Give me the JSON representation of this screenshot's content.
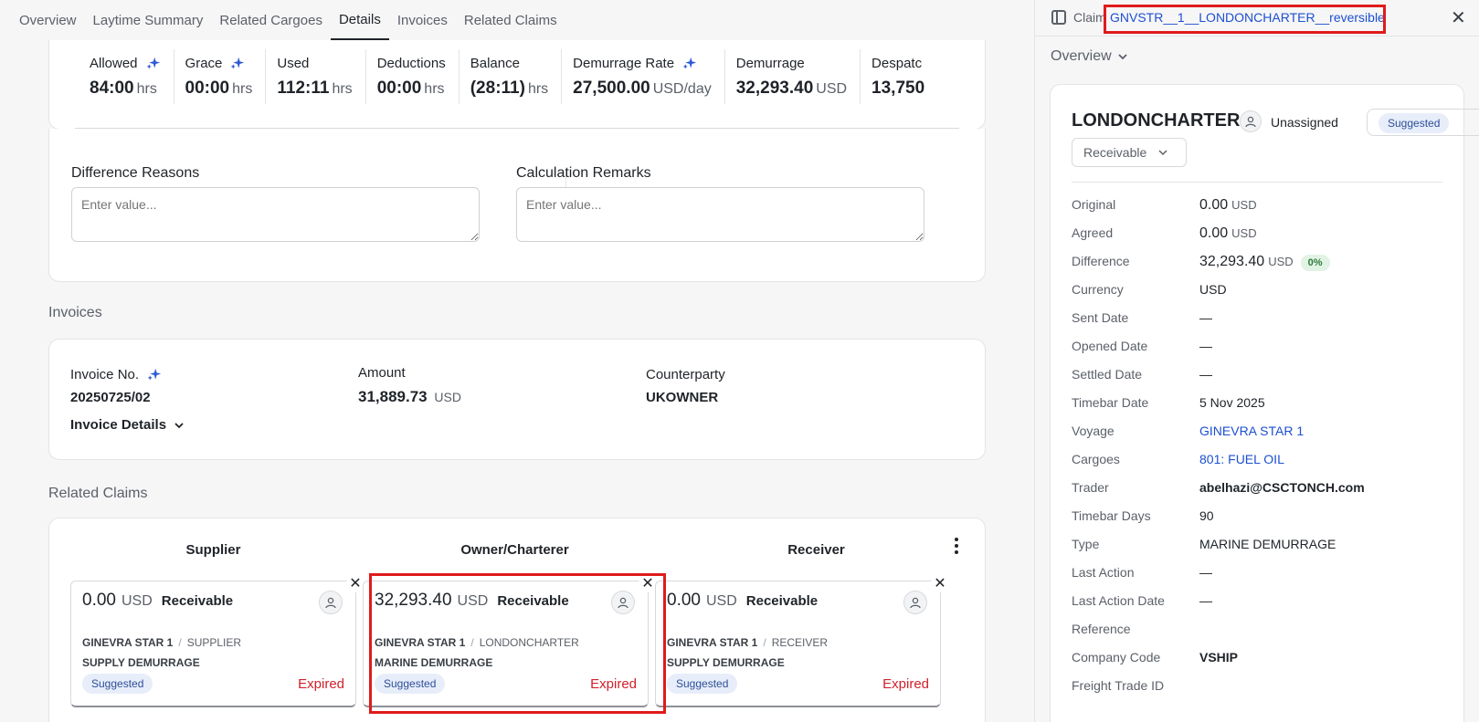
{
  "tabs": [
    "Overview",
    "Laytime Summary",
    "Related Cargoes",
    "Details",
    "Invoices",
    "Related Claims"
  ],
  "stats": [
    {
      "label": "Allowed",
      "value": "84:00",
      "unit": "hrs",
      "sparkle": true
    },
    {
      "label": "Grace",
      "value": "00:00",
      "unit": "hrs",
      "sparkle": true
    },
    {
      "label": "Used",
      "value": "112:11",
      "unit": "hrs",
      "sparkle": false
    },
    {
      "label": "Deductions",
      "value": "00:00",
      "unit": "hrs",
      "sparkle": false
    },
    {
      "label": "Balance",
      "value": "(28:11)",
      "unit": "hrs",
      "sparkle": false
    },
    {
      "label": "Demurrage Rate",
      "value": "27,500.00",
      "unit": "USD/day",
      "sparkle": true
    },
    {
      "label": "Demurrage",
      "value": "32,293.40",
      "unit": "USD",
      "sparkle": false
    },
    {
      "label": "Despatc",
      "value": "13,750",
      "unit": "",
      "sparkle": false
    }
  ],
  "remarks": {
    "difference_label": "Difference Reasons",
    "difference_placeholder": "Enter value...",
    "calculation_label": "Calculation Remarks",
    "calculation_placeholder": "Enter value..."
  },
  "invoices": {
    "section_title": "Invoices",
    "no_label": "Invoice No.",
    "no_value": "20250725/02",
    "amount_label": "Amount",
    "amount_value": "31,889.73",
    "amount_unit": "USD",
    "counterparty_label": "Counterparty",
    "counterparty_value": "UKOWNER",
    "details_label": "Invoice Details"
  },
  "related_claims": {
    "section_title": "Related Claims",
    "columns": [
      "Supplier",
      "Owner/Charterer",
      "Receiver"
    ],
    "cards": [
      {
        "amount": "0.00",
        "currency": "USD",
        "kind": "Receivable",
        "voyage": "GINEVRA STAR 1",
        "party": "SUPPLIER",
        "type": "SUPPLY DEMURRAGE",
        "badge": "Suggested",
        "status": "Expired"
      },
      {
        "amount": "32,293.40",
        "currency": "USD",
        "kind": "Receivable",
        "voyage": "GINEVRA STAR 1",
        "party": "LONDONCHARTER",
        "type": "MARINE DEMURRAGE",
        "badge": "Suggested",
        "status": "Expired"
      },
      {
        "amount": "0.00",
        "currency": "USD",
        "kind": "Receivable",
        "voyage": "GINEVRA STAR 1",
        "party": "RECEIVER",
        "type": "SUPPLY DEMURRAGE",
        "badge": "Suggested",
        "status": "Expired"
      }
    ]
  },
  "panel": {
    "claim_label": "Claim",
    "claim_link": "GNVSTR__1__LONDONCHARTER__reversible",
    "overview_label": "Overview",
    "title": "LONDONCHARTER",
    "unassigned": "Unassigned",
    "status_badge": "Suggested",
    "select_value": "Receivable",
    "fields": [
      {
        "label": "Original",
        "value": "0.00",
        "unit": "USD",
        "style": "big"
      },
      {
        "label": "Agreed",
        "value": "0.00",
        "unit": "USD",
        "style": "big"
      },
      {
        "label": "Difference",
        "value": "32,293.40",
        "unit": "USD",
        "style": "big",
        "pct": "0%"
      },
      {
        "label": "Currency",
        "value": "USD",
        "style": ""
      },
      {
        "label": "Sent Date",
        "value": "—",
        "style": ""
      },
      {
        "label": "Opened Date",
        "value": "—",
        "style": ""
      },
      {
        "label": "Settled Date",
        "value": "—",
        "style": ""
      },
      {
        "label": "Timebar Date",
        "value": "5 Nov 2025",
        "style": ""
      },
      {
        "label": "Voyage",
        "value": "GINEVRA STAR 1",
        "style": "link"
      },
      {
        "label": "Cargoes",
        "value": "801: FUEL OIL",
        "style": "link"
      },
      {
        "label": "Trader",
        "value": "abelhazi@CSCTONCH.com",
        "style": "bold"
      },
      {
        "label": "Timebar Days",
        "value": "90",
        "style": ""
      },
      {
        "label": "Type",
        "value": "MARINE DEMURRAGE",
        "style": ""
      },
      {
        "label": "Last Action",
        "value": "—",
        "style": ""
      },
      {
        "label": "Last Action Date",
        "value": "—",
        "style": ""
      },
      {
        "label": "Reference",
        "value": "",
        "style": ""
      },
      {
        "label": "Company Code",
        "value": "VSHIP",
        "style": "bold"
      },
      {
        "label": "Freight Trade ID",
        "value": "",
        "style": ""
      }
    ]
  },
  "colors": {
    "accent": "#1d4fd1",
    "expired": "#d0212b",
    "highlight": "#e01b1b"
  }
}
